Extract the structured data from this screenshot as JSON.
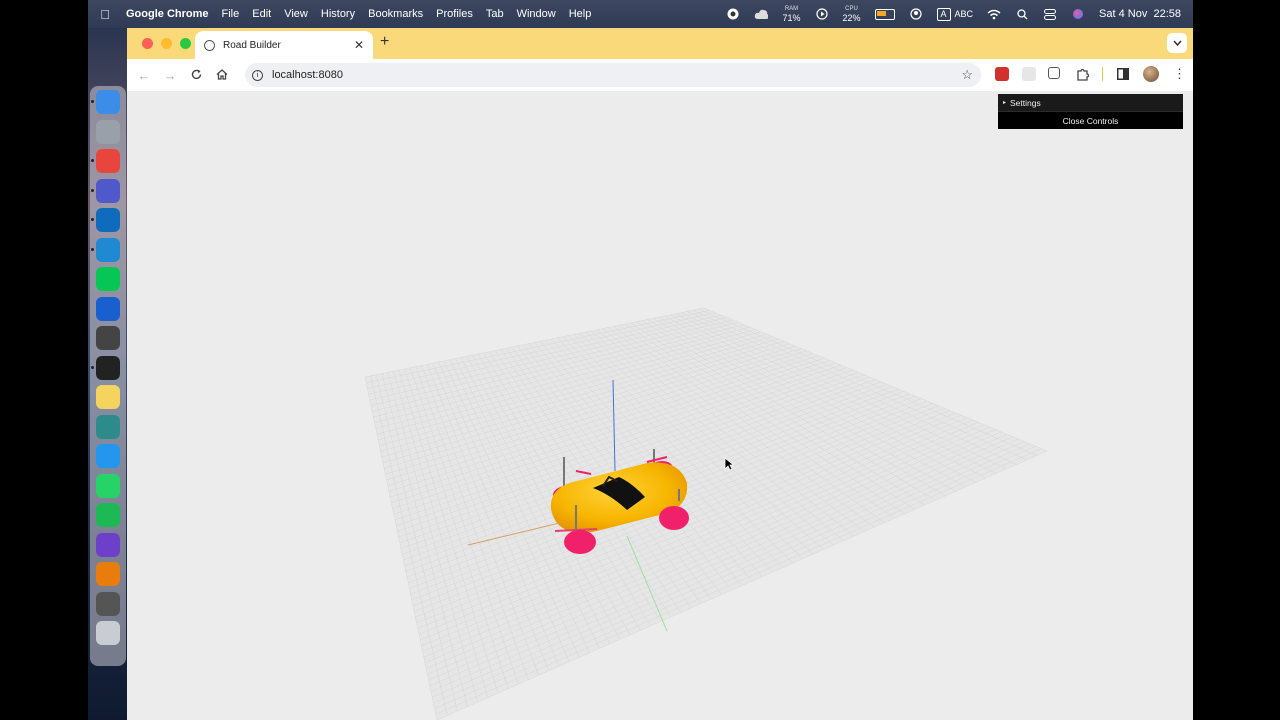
{
  "menubar": {
    "app_name": "Google Chrome",
    "menus": [
      "File",
      "Edit",
      "View",
      "History",
      "Bookmarks",
      "Profiles",
      "Tab",
      "Window",
      "Help"
    ],
    "ram": {
      "label": "RAM",
      "value": "71%"
    },
    "cpu": {
      "label": "CPU",
      "value": "22%"
    },
    "input_source": "ABC",
    "input_badge": "A",
    "clock": "Sat 4 Nov  22:58"
  },
  "dock": {
    "apps": [
      {
        "name": "finder",
        "color": "#3b8de8",
        "running": true
      },
      {
        "name": "launchpad",
        "color": "#9aa0aa",
        "running": false
      },
      {
        "name": "chrome",
        "color": "#e8453c",
        "running": true
      },
      {
        "name": "teams",
        "color": "#5059c9",
        "running": true
      },
      {
        "name": "outlook",
        "color": "#0f6cbd",
        "running": true
      },
      {
        "name": "vscode",
        "color": "#1f8ad2",
        "running": true
      },
      {
        "name": "line",
        "color": "#06c755",
        "running": false
      },
      {
        "name": "maps-pin",
        "color": "#1a5fd0",
        "running": false
      },
      {
        "name": "unity",
        "color": "#444444",
        "running": false
      },
      {
        "name": "terminal",
        "color": "#222222",
        "running": true
      },
      {
        "name": "notes",
        "color": "#f4d35e",
        "running": false
      },
      {
        "name": "activity",
        "color": "#2e8b8b",
        "running": false
      },
      {
        "name": "docker",
        "color": "#2496ed",
        "running": false
      },
      {
        "name": "whatsapp",
        "color": "#25d366",
        "running": false
      },
      {
        "name": "spotify",
        "color": "#1db954",
        "running": false
      },
      {
        "name": "github-desktop",
        "color": "#6e40c9",
        "running": false
      },
      {
        "name": "blender",
        "color": "#e87d0d",
        "running": false
      },
      {
        "name": "calculator",
        "color": "#555555",
        "running": false
      },
      {
        "name": "trash",
        "color": "#c9cdd3",
        "running": false
      }
    ]
  },
  "browser": {
    "tab_title": "Road Builder",
    "url": "localhost:8080"
  },
  "gui": {
    "folder_label": "Settings",
    "close_label": "Close Controls"
  },
  "colors": {
    "tabstrip": "#f9d97a",
    "car_body": "#f7b500",
    "wheels": "#f0206a",
    "grid": "#d6d6d6",
    "floor": "#ececec"
  }
}
